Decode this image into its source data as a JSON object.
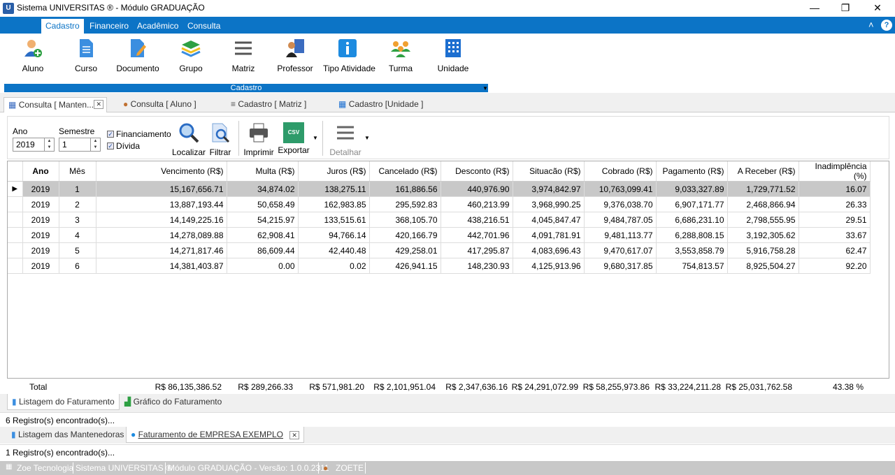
{
  "window": {
    "title": "Sistema UNIVERSITAS ® - Módulo GRADUAÇÃO",
    "minimize": "—",
    "maximize": "❐",
    "close": "✕"
  },
  "menu": {
    "tabs": [
      "Cadastro",
      "Financeiro",
      "Acadêmico",
      "Consulta"
    ],
    "collapse": "˄",
    "help": "?"
  },
  "ribbon": {
    "items": [
      "Aluno",
      "Curso",
      "Documento",
      "Grupo",
      "Matriz",
      "Professor",
      "Tipo Atividade",
      "Turma",
      "Unidade"
    ],
    "group_label": "Cadastro"
  },
  "doc_tabs": [
    "Consulta [ Manten...",
    "Consulta [ Aluno ]",
    "Cadastro [ Matriz ]",
    "Cadastro [Unidade ]"
  ],
  "filters": {
    "ano_label": "Ano",
    "ano_value": "2019",
    "semestre_label": "Semestre",
    "semestre_value": "1",
    "financiamento_label": "Financiamento",
    "divida_label": "Dívida"
  },
  "toolbar": {
    "localizar": "Localizar",
    "filtrar": "Filtrar",
    "imprimir": "Imprimir",
    "exportar": "Exportar",
    "detalhar": "Detalhar",
    "csv": "CSV"
  },
  "grid": {
    "columns": [
      "Ano",
      "Mês",
      "Vencimento (R$)",
      "Multa (R$)",
      "Juros (R$)",
      "Cancelado (R$)",
      "Desconto (R$)",
      "Situacão (R$)",
      "Cobrado (R$)",
      "Pagamento (R$)",
      "A Receber (R$)",
      "Inadimplência (%)"
    ],
    "rows": [
      [
        "2019",
        "1",
        "15,167,656.71",
        "34,874.02",
        "138,275.11",
        "161,886.56",
        "440,976.90",
        "3,974,842.97",
        "10,763,099.41",
        "9,033,327.89",
        "1,729,771.52",
        "16.07"
      ],
      [
        "2019",
        "2",
        "13,887,193.44",
        "50,658.49",
        "162,983.85",
        "295,592.83",
        "460,213.99",
        "3,968,990.25",
        "9,376,038.70",
        "6,907,171.77",
        "2,468,866.94",
        "26.33"
      ],
      [
        "2019",
        "3",
        "14,149,225.16",
        "54,215.97",
        "133,515.61",
        "368,105.70",
        "438,216.51",
        "4,045,847.47",
        "9,484,787.05",
        "6,686,231.10",
        "2,798,555.95",
        "29.51"
      ],
      [
        "2019",
        "4",
        "14,278,089.88",
        "62,908.41",
        "94,766.14",
        "420,166.79",
        "442,701.96",
        "4,091,781.91",
        "9,481,113.77",
        "6,288,808.15",
        "3,192,305.62",
        "33.67"
      ],
      [
        "2019",
        "5",
        "14,271,817.46",
        "86,609.44",
        "42,440.48",
        "429,258.01",
        "417,295.87",
        "4,083,696.43",
        "9,470,617.07",
        "3,553,858.79",
        "5,916,758.28",
        "62.47"
      ],
      [
        "2019",
        "6",
        "14,381,403.87",
        "0.00",
        "0.02",
        "426,941.15",
        "148,230.93",
        "4,125,913.96",
        "9,680,317.85",
        "754,813.57",
        "8,925,504.27",
        "92.20"
      ]
    ],
    "totals_label": "Total",
    "totals": [
      "R$ 86,135,386.52",
      "R$ 289,266.33",
      "R$ 571,981.20",
      "R$ 2,101,951.04",
      "R$ 2,347,636.16",
      "R$ 24,291,072.99",
      "R$ 58,255,973.86",
      "R$ 33,224,211.28",
      "R$ 25,031,762.58",
      "43.38 %"
    ]
  },
  "inner_tabs": [
    "Listagem do Faturamento",
    "Gráfico do Faturamento"
  ],
  "inner_status": "6 Registro(s) encontrado(s)...",
  "outer_tabs": [
    "Listagem das Mantenedoras",
    "Faturamento de EMPRESA EXEMPLO"
  ],
  "outer_status": "1 Registro(s) encontrado(s)...",
  "statusbar": [
    "Zoe Tecnologia",
    "Sistema UNIVERSITAS ®",
    "Módulo GRADUAÇÃO - Versão: 1.0.0.2311",
    "ZOETE"
  ],
  "colors": {
    "accent": "#0c74c6",
    "selected_row": "#c8c8c8",
    "statusbar": "#c8c8c8"
  }
}
